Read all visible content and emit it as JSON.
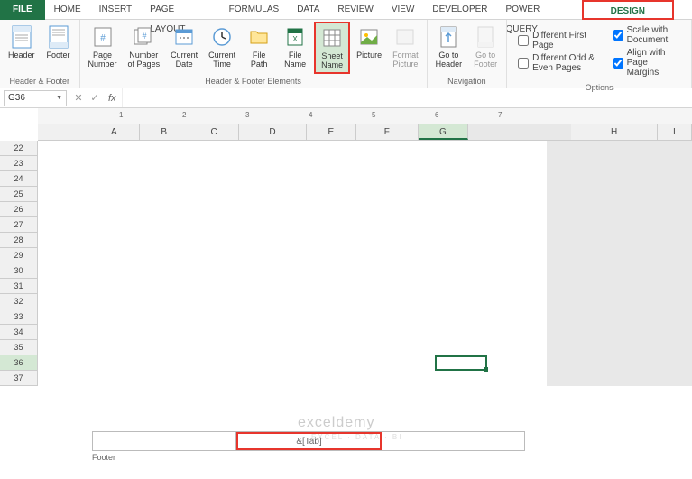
{
  "tabs": {
    "file": "FILE",
    "home": "HOME",
    "insert": "INSERT",
    "page_layout": "PAGE LAYOUT",
    "formulas": "FORMULAS",
    "data": "DATA",
    "review": "REVIEW",
    "view": "VIEW",
    "developer": "DEVELOPER",
    "power_query": "POWER QUERY",
    "design": "DESIGN"
  },
  "ribbon": {
    "header_footer": {
      "header": "Header",
      "footer": "Footer",
      "group_label": "Header & Footer"
    },
    "elements": {
      "page_number": "Page\nNumber",
      "number_of_pages": "Number\nof Pages",
      "current_date": "Current\nDate",
      "current_time": "Current\nTime",
      "file_path": "File\nPath",
      "file_name": "File\nName",
      "sheet_name": "Sheet\nName",
      "picture": "Picture",
      "format_picture": "Format\nPicture",
      "group_label": "Header & Footer Elements"
    },
    "navigation": {
      "go_to_header": "Go to\nHeader",
      "go_to_footer": "Go to\nFooter",
      "group_label": "Navigation"
    },
    "options": {
      "different_first": "Different First Page",
      "different_odd_even": "Different Odd & Even Pages",
      "scale_with_doc": "Scale with Document",
      "align_margins": "Align with Page Margins",
      "group_label": "Options"
    }
  },
  "name_box": "G36",
  "columns": [
    "A",
    "B",
    "C",
    "D",
    "E",
    "F",
    "G"
  ],
  "columns_right": [
    "H",
    "I"
  ],
  "rows": [
    22,
    23,
    24,
    25,
    26,
    27,
    28,
    29,
    30,
    31,
    32,
    33,
    34,
    35,
    36,
    37
  ],
  "ruler_marks": [
    "1",
    "2",
    "3",
    "4",
    "5",
    "6",
    "7"
  ],
  "footer": {
    "center_content": "&[Tab]",
    "label": "Footer"
  },
  "watermark": {
    "main": "exceldemy",
    "sub": "EXCEL · DATA · BI"
  },
  "selected_cell": {
    "col": "G",
    "row": 36
  }
}
